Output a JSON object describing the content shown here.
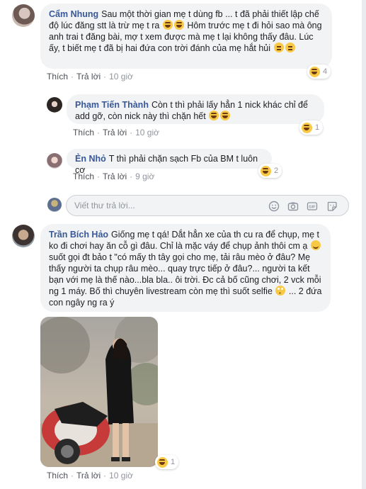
{
  "comments": [
    {
      "author": "Cẩm Nhung",
      "text": "Sau một thời gian mẹ t dùng fb ... t đã phải thiết lập chế độ lúc đăng stt là trừ mẹ t ra",
      "text2": "Hôm trước mẹ t đi hỏi sao mà ông anh trai t đăng bài, mợ t xem được mà mẹ t lại không thấy đâu. Lúc ấy, t biết mẹ t đã bị hai đứa con trời đánh của mẹ hắt hủi",
      "like": "Thích",
      "reply": "Trả lời",
      "time": "10 giờ",
      "reaction_count": "4"
    },
    {
      "author": "Phạm Tiến Thành",
      "text": "Còn t thì phải lấy hẳn 1 nick khác chỉ để add gỡ, còn nick này thì chặn hết",
      "like": "Thích",
      "reply": "Trả lời",
      "time": "10 giờ",
      "reaction_count": "1"
    },
    {
      "author": "Ẻn Nhỏ",
      "text": "T thì phải chặn sạch Fb của BM t luôn cơ",
      "like": "Thích",
      "reply": "Trả lời",
      "time": "9 giờ",
      "reaction_count": "2"
    },
    {
      "author": "Trần Bích Hảo",
      "text": "Giống mẹ t qá! Dắt hẳn xe của th cu ra để chụp, mẹ t ko đi chơi hay ăn cỗ gì đâu. Chỉ là mặc váy để chụp ảnh thôi cm ạ",
      "text2": "suốt gọi đt bảo t \"có mấy th tây gọi cho mẹ, tải râu mèo ở đâu? Mẹ thấy người ta chụp râu mèo... quay trực tiếp ở đâu?... người ta kết bạn với mẹ là thế nào...bla bla.. ôi trời. Đc cả bố cũng chơi, 2 vck mỗi ng 1 máy. Bố thì chuyên livestream còn mẹ thì suốt selfie",
      "text3": "... 2 đứa con ngây ng ra ý",
      "like": "Thích",
      "reply": "Trả lời",
      "time": "10 giờ",
      "reaction_count": "1"
    }
  ],
  "reply_box": {
    "placeholder": "Viết thư trả lời..."
  },
  "icons": [
    "emoji-icon",
    "camera-icon",
    "gif-icon",
    "sticker-icon",
    "laugh-reaction-icon"
  ],
  "colors": {
    "name": "#385898",
    "bubble": "#f2f3f5",
    "meta": "#90949c"
  }
}
